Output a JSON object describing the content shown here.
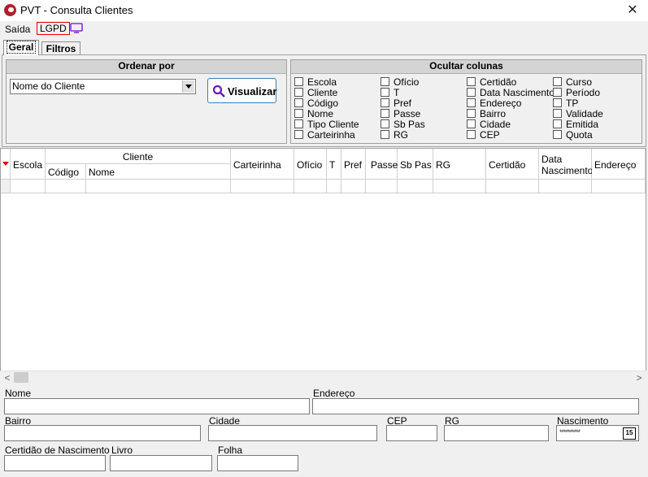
{
  "window": {
    "title": "PVT - Consulta Clientes"
  },
  "menu": {
    "saida": "Saída",
    "lgpd": "LGPD"
  },
  "tabs": [
    {
      "label": "Geral"
    },
    {
      "label": "Filtros"
    }
  ],
  "ordenar": {
    "header": "Ordenar por",
    "selected": "Nome do Cliente",
    "button_label": "Visualizar"
  },
  "ocultar": {
    "header": "Ocultar colunas",
    "columns": [
      [
        "Escola",
        "Cliente",
        "Código",
        "Nome",
        "Tipo Cliente",
        "Carteirinha"
      ],
      [
        "Ofício",
        "T",
        "Pref",
        "Passe",
        "Sb Pas",
        "RG"
      ],
      [
        "Certidão",
        "Data Nascimento",
        "Endereço",
        "Bairro",
        "Cidade",
        "CEP"
      ],
      [
        "Curso",
        "Período",
        "TP",
        "Validade",
        "Emitida",
        "Quota"
      ]
    ]
  },
  "grid": {
    "headers": {
      "escola": "Escola",
      "cliente": "Cliente",
      "codigo": "Código",
      "nome": "Nome",
      "carteirinha": "Carteirinha",
      "oficio": "Ofício",
      "t": "T",
      "pref": "Pref",
      "passe": "Passe",
      "sbpas": "Sb Pas",
      "rg": "RG",
      "certidao": "Certidão",
      "datanasc": "Data Nascimento",
      "endereco": "Endereço"
    }
  },
  "form": {
    "nome": "Nome",
    "endereco": "Endereço",
    "bairro": "Bairro",
    "cidade": "Cidade",
    "cep": "CEP",
    "rg": "RG",
    "nascimento": "Nascimento",
    "nascimento_value": "**********",
    "calendar_day": "15",
    "certidao": "Certidão de Nascimento",
    "livro": "Livro",
    "folha": "Folha"
  },
  "colors": {
    "accent_red": "#e00000",
    "monitor_purple": "#8a2be2",
    "button_border": "#3c7fb1"
  }
}
